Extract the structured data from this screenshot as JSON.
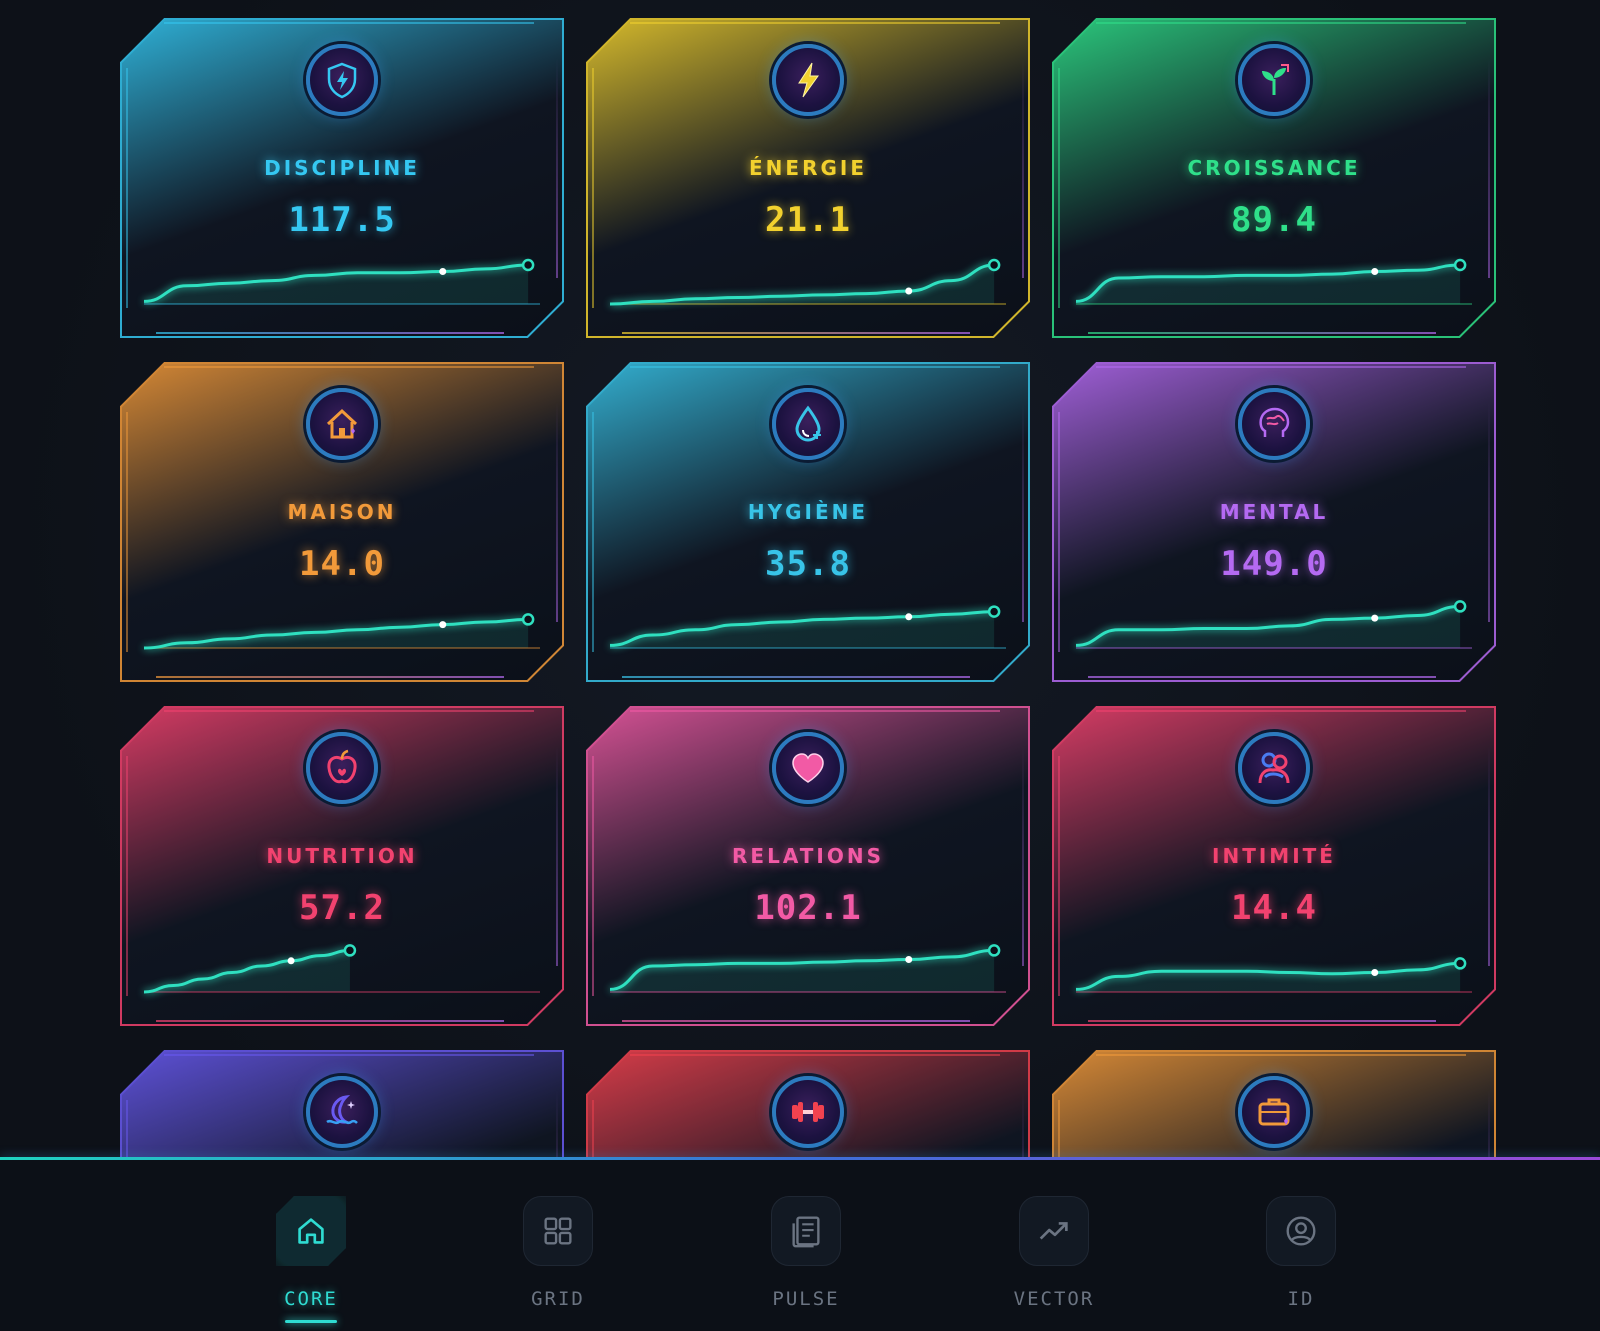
{
  "cards": [
    {
      "id": "discipline",
      "label": "DISCIPLINE",
      "value": "117.5",
      "color": "#35c8f2",
      "icon": "shield-bolt-icon",
      "trend": [
        2,
        14,
        16,
        18,
        22,
        24,
        24,
        25,
        27,
        30
      ]
    },
    {
      "id": "energie",
      "label": "ÉNERGIE",
      "value": "21.1",
      "color": "#f2d12e",
      "icon": "lightning-icon",
      "trend": [
        0,
        2,
        4,
        5,
        6,
        7,
        8,
        10,
        18,
        30
      ]
    },
    {
      "id": "croissance",
      "label": "CROISSANCE",
      "value": "89.4",
      "color": "#2fe08a",
      "icon": "sprout-growth-icon",
      "trend": [
        2,
        20,
        21,
        21,
        22,
        22,
        23,
        25,
        26,
        30
      ]
    },
    {
      "id": "maison",
      "label": "MAISON",
      "value": "14.0",
      "color": "#f29a3a",
      "icon": "house-icon",
      "trend": [
        0,
        4,
        7,
        10,
        12,
        14,
        16,
        18,
        20,
        22
      ]
    },
    {
      "id": "hygiene",
      "label": "HYGIÈNE",
      "value": "35.8",
      "color": "#38c4e8",
      "icon": "water-drop-icon",
      "trend": [
        2,
        10,
        14,
        18,
        20,
        22,
        23,
        24,
        26,
        28
      ]
    },
    {
      "id": "mental",
      "label": "MENTAL",
      "value": "149.0",
      "color": "#b56af2",
      "icon": "brain-head-icon",
      "trend": [
        2,
        14,
        14,
        15,
        15,
        17,
        22,
        23,
        25,
        32
      ]
    },
    {
      "id": "nutrition",
      "label": "NUTRITION",
      "value": "57.2",
      "color": "#f2426f",
      "icon": "apple-icon",
      "trend": [
        0,
        5,
        10,
        15,
        20,
        24,
        28,
        32
      ]
    },
    {
      "id": "relations",
      "label": "RELATIONS",
      "value": "102.1",
      "color": "#f25aa5",
      "icon": "heart-icon",
      "trend": [
        2,
        20,
        21,
        22,
        22,
        23,
        24,
        25,
        27,
        32
      ]
    },
    {
      "id": "intimite",
      "label": "INTIMITÉ",
      "value": "14.4",
      "color": "#f2426f",
      "icon": "embrace-icon",
      "trend": [
        2,
        12,
        16,
        16,
        16,
        15,
        14,
        15,
        17,
        22
      ]
    },
    {
      "id": "sleep",
      "label": "",
      "value": "",
      "color": "#6a5af2",
      "icon": "moon-wave-icon",
      "trend": []
    },
    {
      "id": "fitness",
      "label": "",
      "value": "",
      "color": "#f2424f",
      "icon": "dumbbell-icon",
      "trend": []
    },
    {
      "id": "work",
      "label": "",
      "value": "",
      "color": "#f29a3a",
      "icon": "briefcase-icon",
      "trend": []
    }
  ],
  "nav": [
    {
      "id": "core",
      "label": "CORE",
      "icon": "home-icon",
      "active": true
    },
    {
      "id": "grid",
      "label": "GRID",
      "icon": "grid-icon",
      "active": false
    },
    {
      "id": "pulse",
      "label": "PULSE",
      "icon": "document-icon",
      "active": false
    },
    {
      "id": "vector",
      "label": "VECTOR",
      "icon": "trend-up-icon",
      "active": false
    },
    {
      "id": "id",
      "label": "ID",
      "icon": "user-circle-icon",
      "active": false
    }
  ],
  "accent": {
    "sparkline": "#2fe0c0",
    "divider_start": "#1fd3c0",
    "divider_end": "#9b4ad8"
  }
}
